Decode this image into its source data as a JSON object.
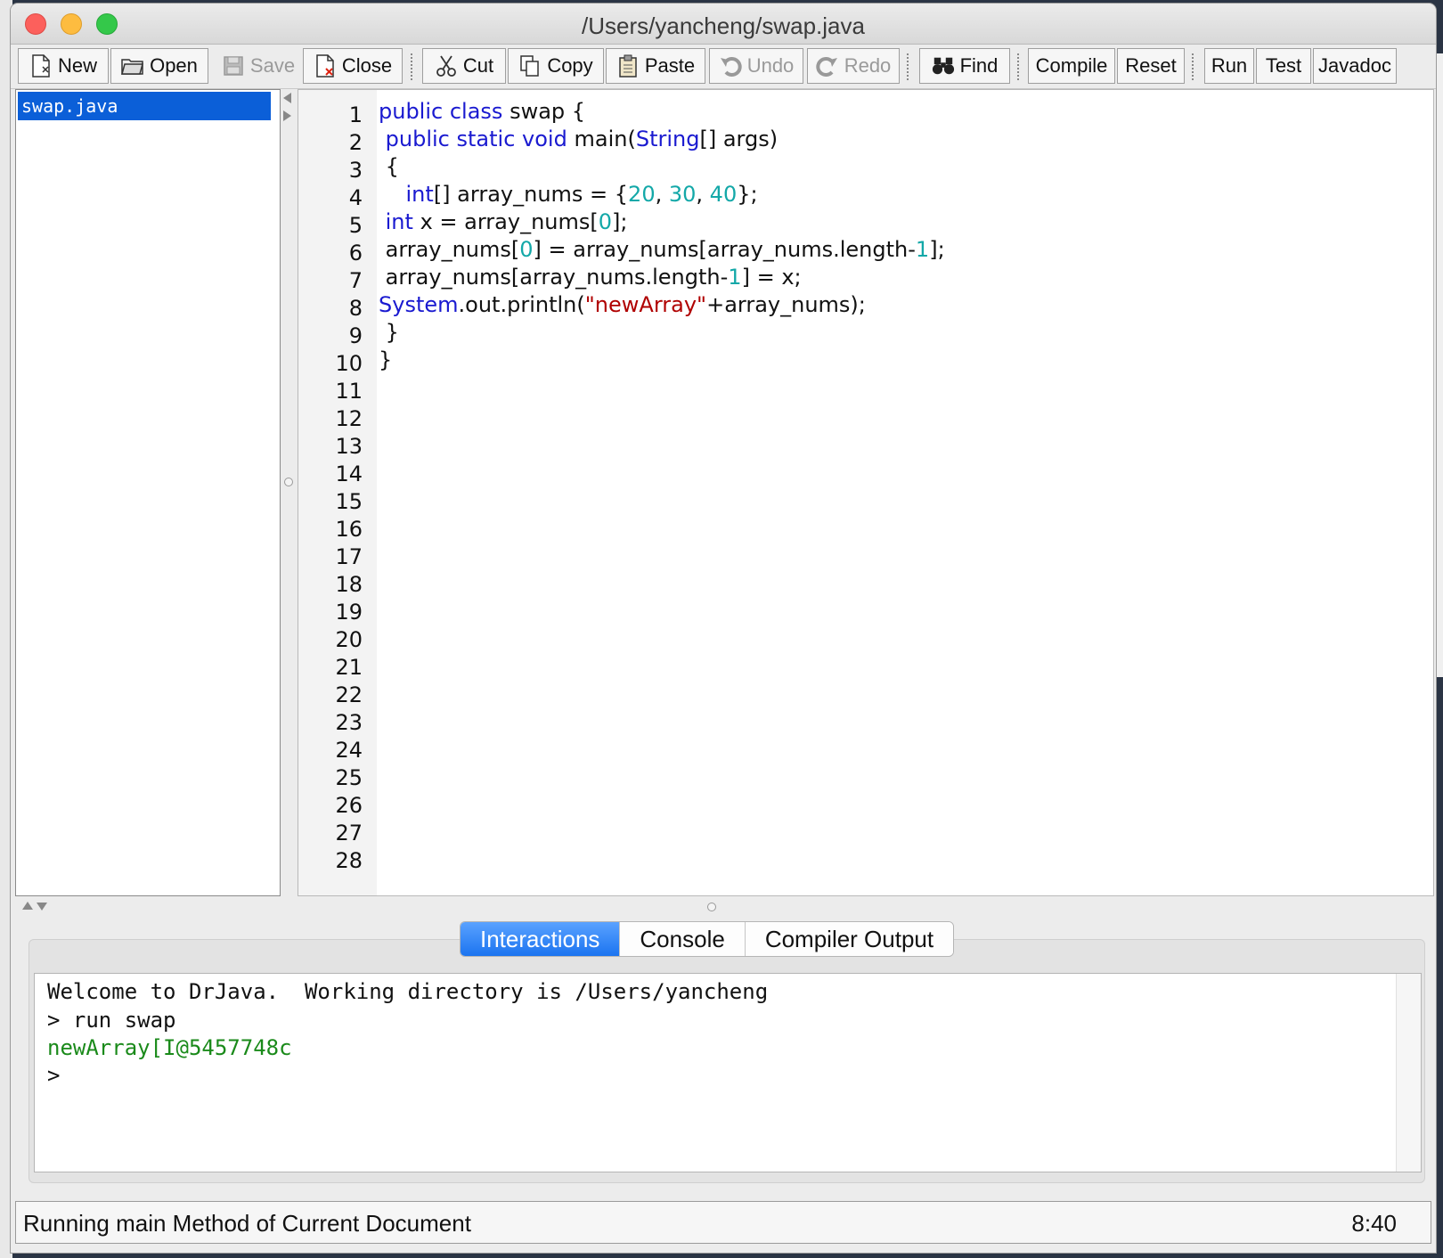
{
  "window": {
    "title": "/Users/yancheng/swap.java"
  },
  "toolbar": {
    "buttons": [
      {
        "label": "New",
        "icon": "new-file-icon"
      },
      {
        "label": "Open",
        "icon": "open-folder-icon"
      },
      {
        "label": "Save",
        "icon": "save-disk-icon",
        "disabled": true
      },
      {
        "label": "Close",
        "icon": "close-file-icon"
      },
      {
        "label": "Cut",
        "icon": "scissors-icon"
      },
      {
        "label": "Copy",
        "icon": "copy-icon"
      },
      {
        "label": "Paste",
        "icon": "clipboard-icon"
      },
      {
        "label": "Undo",
        "icon": "undo-icon",
        "disabled": true
      },
      {
        "label": "Redo",
        "icon": "redo-icon",
        "disabled": true
      },
      {
        "label": "Find",
        "icon": "binoculars-icon"
      },
      {
        "label": "Compile"
      },
      {
        "label": "Reset"
      },
      {
        "label": "Run"
      },
      {
        "label": "Test"
      },
      {
        "label": "Javadoc"
      }
    ]
  },
  "documents": {
    "items": [
      {
        "name": "swap.java",
        "selected": true
      }
    ]
  },
  "editor": {
    "line_numbers": [
      "1",
      "2",
      "3",
      "4",
      "5",
      "6",
      "7",
      "8",
      "9",
      "10",
      "11",
      "12",
      "13",
      "14",
      "15",
      "16",
      "17",
      "18",
      "19",
      "20",
      "21",
      "22",
      "23",
      "24",
      "25",
      "26",
      "27",
      "28"
    ],
    "lines": [
      "public class swap {",
      " public static void main(String[] args)",
      " {",
      "    int[] array_nums = {20, 30, 40};",
      " int x = array_nums[0];",
      " array_nums[0] = array_nums[array_nums.length-1];",
      " array_nums[array_nums.length-1] = x;",
      "System.out.println(\"newArray\"+array_nums);",
      " }",
      "}"
    ]
  },
  "bottom_tabs": [
    {
      "label": "Interactions",
      "active": true
    },
    {
      "label": "Console"
    },
    {
      "label": "Compiler Output"
    }
  ],
  "interactions": {
    "lines": [
      "Welcome to DrJava.  Working directory is /Users/yancheng",
      "> run swap",
      "newArray[I@5457748c",
      ">"
    ]
  },
  "status": {
    "message": "Running main Method of Current Document",
    "position": "8:40"
  },
  "colors": {
    "keyword": "#1a1ad0",
    "number": "#13a8a8",
    "string": "#b00000",
    "output": "#1a8a1a",
    "selection": "#0b5fd8"
  }
}
